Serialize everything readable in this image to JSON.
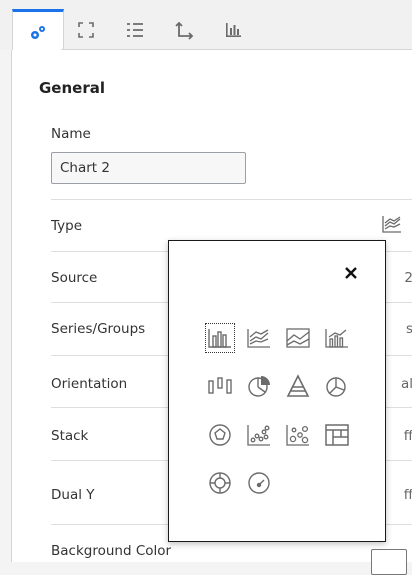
{
  "tabs": [
    {
      "icon": "gears-icon",
      "active": true
    },
    {
      "icon": "fullscreen-icon",
      "active": false
    },
    {
      "icon": "list-icon",
      "active": false
    },
    {
      "icon": "axis-icon",
      "active": false
    },
    {
      "icon": "bar-chart-icon",
      "active": false
    }
  ],
  "section": {
    "title": "General"
  },
  "name": {
    "label": "Name",
    "value": "Chart 2"
  },
  "rows": {
    "type": {
      "label": "Type"
    },
    "source": {
      "label": "Source",
      "value_clip": "2"
    },
    "series_groups": {
      "label": "Series/Groups",
      "value_clip": "s"
    },
    "orientation": {
      "label": "Orientation",
      "value_clip": "al"
    },
    "stack": {
      "label": "Stack",
      "value_clip": "ff"
    },
    "dual_y": {
      "label": "Dual Y",
      "value_clip": "ff"
    },
    "background": {
      "label": "Background Color"
    }
  },
  "chart_types": [
    "bar-chart-icon",
    "line-chart-icon",
    "area-chart-icon",
    "combo-chart-icon",
    "range-chart-icon",
    "pie-chart-icon",
    "pyramid-chart-icon",
    "donut-pie-chart-icon",
    "polar-chart-icon",
    "scatter-chart-icon",
    "bubble-chart-icon",
    "treemap-chart-icon",
    "sunburst-chart-icon",
    "gauge-chart-icon"
  ],
  "selected_chart_type": "bar-chart-icon",
  "colors": {
    "accent": "#1a73e8",
    "icon": "#6b6b6b"
  }
}
